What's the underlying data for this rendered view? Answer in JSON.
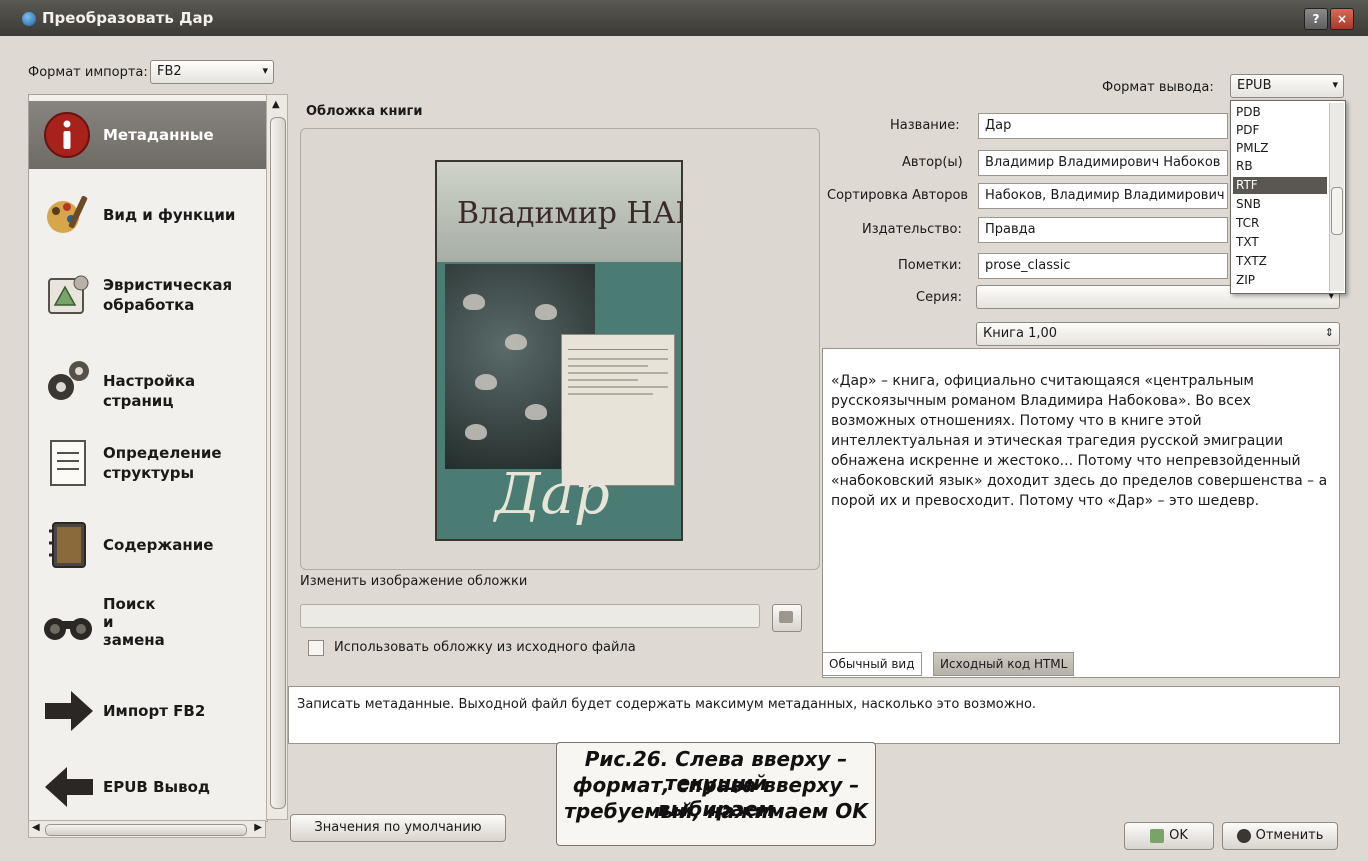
{
  "window": {
    "title": "Преобразовать Дар",
    "help_label": "?",
    "close_label": "×"
  },
  "import": {
    "label": "Формат импорта:",
    "value": "FB2"
  },
  "output": {
    "label": "Формат вывода:",
    "value": "EPUB",
    "options": [
      "PDB",
      "PDF",
      "PMLZ",
      "RB",
      "RTF",
      "SNB",
      "TCR",
      "TXT",
      "TXTZ",
      "ZIP"
    ],
    "selected": "RTF"
  },
  "sidebar": {
    "items": [
      {
        "label": "Метаданные",
        "icon": "info-icon"
      },
      {
        "label": "Вид и функции",
        "icon": "look-and-feel-icon"
      },
      {
        "label": "Эвристическая\nобработка",
        "icon": "heuristics-icon"
      },
      {
        "label": "Настройка страниц",
        "icon": "page-setup-icon"
      },
      {
        "label": "Определение\nструктуры",
        "icon": "structure-icon"
      },
      {
        "label": "Содержание",
        "icon": "toc-icon"
      },
      {
        "label": "Поиск\nи\nзамена",
        "icon": "search-replace-icon"
      },
      {
        "label": "Импорт FB2",
        "icon": "arrow-right-icon"
      },
      {
        "label": "EPUB Вывод",
        "icon": "arrow-left-icon"
      }
    ]
  },
  "cover": {
    "heading": "Обложка книги",
    "author": "Владимир НАБОКОВ",
    "title_art": "Дар",
    "change_label": "Изменить изображение обложки",
    "use_source_label": "Использовать обложку из исходного файла"
  },
  "meta": {
    "title_label": "Название:",
    "title": "Дар",
    "author_label": "Автор(ы)",
    "author": "Владимир Владимирович Набоков",
    "sort_label": "Сортировка Авторов",
    "sort": "Набоков, Владимир Владимирович",
    "publisher_label": "Издательство:",
    "publisher": "Правда",
    "tags_label": "Пометки:",
    "tags": "prose_classic",
    "series_label": "Серия:",
    "series": "",
    "book_num": "Книга 1,00"
  },
  "comment": {
    "text": "«Дар» – книга, официально считающаяся «центральным русскоязычным романом Владимира Набокова». Во всех возможных отношениях. Потому что в книге этой интеллектуальная и этическая трагедия русской эмиграции обнажена искренне и жестоко... Потому что непревзойденный «набоковский язык» доходит здесь до пределов совершенства – а порой их и превосходит. Потому что «Дар» – это шедевр.",
    "tab_normal": "Обычный вид",
    "tab_html": "Исходный код HTML"
  },
  "status": "Записать метаданные. Выходной файл будет содержать максимум метаданных, насколько это возможно.",
  "buttons": {
    "defaults": "Значения по умолчанию",
    "ok": "OK",
    "cancel": "Отменить"
  },
  "caption": [
    "Рис.26. Слева вверху – текущий",
    "формат, справа вверху – выбираем",
    "требуемый, нажимаем OK"
  ],
  "colors": {
    "selected_nav": "#7a7670",
    "dropdown_highlight": "#5a5752",
    "titlebar": "#4a4844"
  }
}
